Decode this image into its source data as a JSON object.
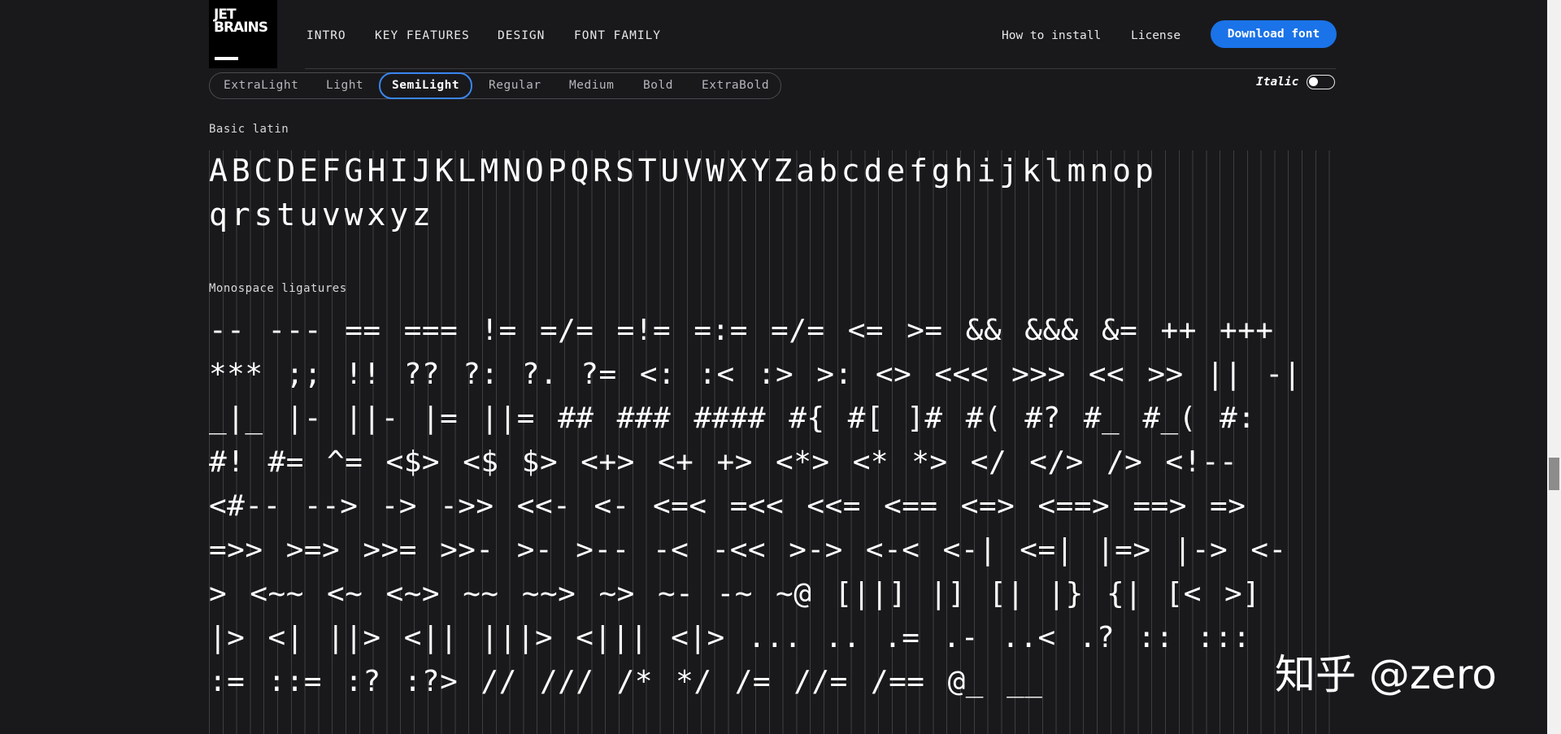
{
  "logo": {
    "line1": "JET",
    "line2": "BRAINS"
  },
  "nav": {
    "items": [
      "INTRO",
      "KEY FEATURES",
      "DESIGN",
      "FONT FAMILY"
    ],
    "how_to_install": "How to install",
    "license": "License",
    "download": "Download font"
  },
  "weights": {
    "items": [
      "ExtraLight",
      "Light",
      "SemiLight",
      "Regular",
      "Medium",
      "Bold",
      "ExtraBold"
    ],
    "selected": "SemiLight",
    "italic_label": "Italic"
  },
  "sections": {
    "basic_latin_label": "Basic latin",
    "basic_latin_line1": "ABCDEFGHIJKLMNOPQRSTUVWXYZabcdefghijklmnop",
    "basic_latin_line2": "qrstuvwxyz",
    "ligatures_label": "Monospace ligatures",
    "ligature_lines": [
      "-- --- == === != =/= =!= =:= =/= <= >= && &&& &= ++ +++",
      "*** ;; !! ?? ?: ?. ?= <: :< :> >: <> <<< >>> << >> || -|",
      "_|_ |- ||- |= ||= ## ### #### #{ #[ ]# #( #? #_ #_( #:",
      "#! #= ^= <$> <$ $> <+> <+ +> <*> <* *> </ </> /> <!--",
      "<#-- --> -> ->> <<- <- <=< =<< <<= <== <=> <==> ==> =>",
      "=>> >=> >>= >>- >- >-- -< -<< >-> <-< <-| <=| |=> |-> <-",
      "> <~~ <~ <~> ~~ ~~> ~> ~- -~ ~@ [||] |] [| |} {| [< >]",
      "|> <| ||> <|| |||> <||| <|> ... .. .= .- ..< .? :: :::",
      ":= ::= :? :?> // /// /* */ /= //= /== @_ __"
    ]
  },
  "watermark": "知乎 @zero"
}
